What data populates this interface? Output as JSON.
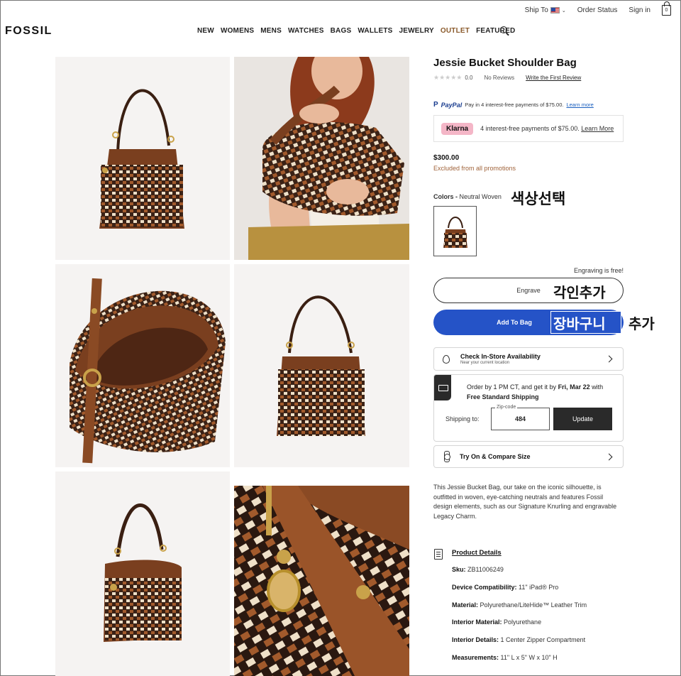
{
  "utility": {
    "ship_to": "Ship To",
    "order_status": "Order Status",
    "sign_in": "Sign in",
    "bag_count": "0"
  },
  "header": {
    "logo": "FOSSIL",
    "nav": [
      "NEW",
      "WOMENS",
      "MENS",
      "WATCHES",
      "BAGS",
      "WALLETS",
      "JEWELRY",
      "OUTLET",
      "FEATURED"
    ]
  },
  "product": {
    "title": "Jessie Bucket Shoulder Bag",
    "rating_value": "0.0",
    "reviews": "No Reviews",
    "write_review": "Write the First Review",
    "paypal_logo": "PayPal",
    "paypal_text": "Pay in 4 interest-free payments of $75.00.",
    "paypal_learn": "Learn more",
    "klarna_logo": "Klarna",
    "klarna_text": "4 interest-free payments of $75.00.",
    "klarna_learn": "Learn More",
    "price": "$300.00",
    "promo_note": "Excluded from all promotions",
    "colors_label": "Colors -",
    "color_name": "Neutral Woven",
    "engraving_free": "Engraving is free!",
    "engrave_label": "Engrave",
    "add_to_bag_label": "Add To Bag"
  },
  "annotations": {
    "color_select": "색상선택",
    "engrave": "각인추가",
    "cart": "장바구니",
    "add": "추가"
  },
  "store": {
    "title": "Check In-Store Availability",
    "subtitle": "Near your current location"
  },
  "shipping": {
    "line1_pre": "Order by 1 PM CT, and get it by",
    "line1_date": "Fri, Mar 22",
    "line1_post": "with",
    "line2": "Free Standard Shipping",
    "label": "Shipping to:",
    "zip_label": "Zip-code",
    "zip_value": "484",
    "update_label": "Update"
  },
  "try_on": {
    "title": "Try On & Compare Size"
  },
  "description": "This Jessie Bucket Bag, our take on the iconic silhouette, is outfitted in woven, eye-catching neutrals and features Fossil design elements, such as our Signature Knurling and engravable Legacy Charm.",
  "details": {
    "title": "Product Details",
    "specs": [
      {
        "label": "Sku:",
        "value": "ZB11006249"
      },
      {
        "label": "Device Compatibility:",
        "value": "11\" iPad® Pro"
      },
      {
        "label": "Material:",
        "value": "Polyurethane/LiteHide™ Leather Trim"
      },
      {
        "label": "Interior Material:",
        "value": "Polyurethane"
      },
      {
        "label": "Interior Details:",
        "value": "1 Center Zipper Compartment"
      },
      {
        "label": "Measurements:",
        "value": "11\" L x 5\" W x 10\" H"
      }
    ]
  }
}
